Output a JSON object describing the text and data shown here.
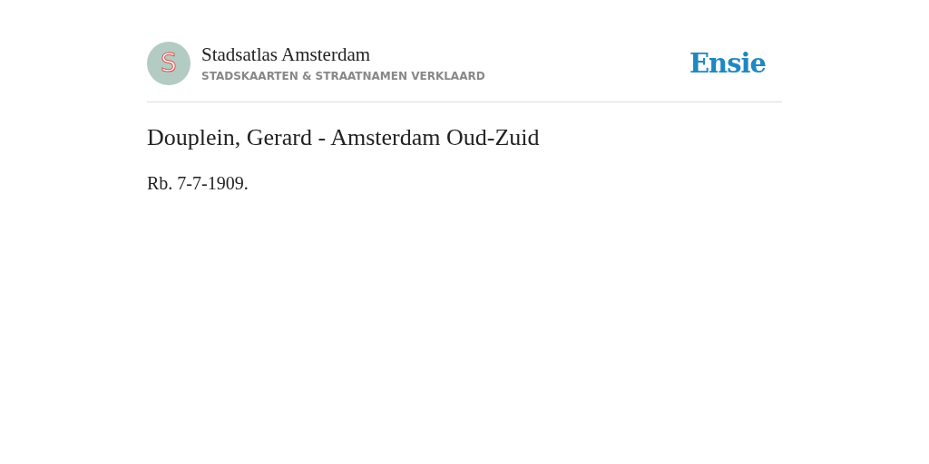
{
  "header": {
    "logo_letter": "S",
    "site_title": "Stadsatlas Amsterdam",
    "tagline": "STADSKAARTEN & STRAATNAMEN VERKLAARD",
    "brand": "Ensie"
  },
  "article": {
    "title": "Douplein, Gerard - Amsterdam Oud-Zuid",
    "body": "Rb. 7-7-1909."
  }
}
